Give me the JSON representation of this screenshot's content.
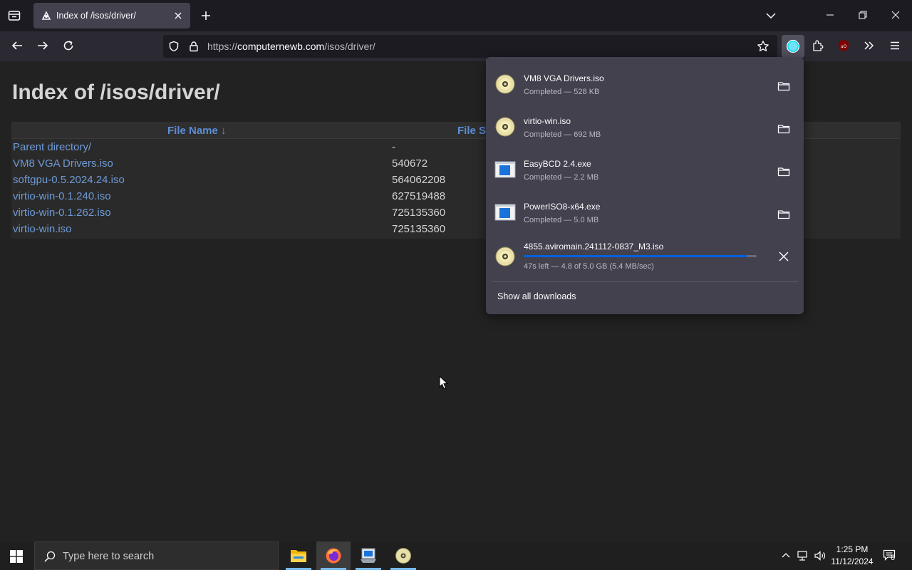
{
  "tab": {
    "title": "Index of /isos/driver/"
  },
  "urlbar": {
    "scheme": "https://",
    "host": "computernewb.com",
    "path": "/isos/driver/"
  },
  "page": {
    "title": "Index of /isos/driver/",
    "columns": {
      "name": "File Name  ↓",
      "size": "File S"
    },
    "rows": [
      {
        "name": "Parent directory/",
        "size": "-"
      },
      {
        "name": "VM8 VGA Drivers.iso",
        "size": "540672"
      },
      {
        "name": "softgpu-0.5.2024.24.iso",
        "size": "564062208"
      },
      {
        "name": "virtio-win-0.1.240.iso",
        "size": "627519488"
      },
      {
        "name": "virtio-win-0.1.262.iso",
        "size": "725135360"
      },
      {
        "name": "virtio-win.iso",
        "size": "725135360"
      }
    ]
  },
  "downloads": {
    "items": [
      {
        "name": "VM8 VGA Drivers.iso",
        "status": "Completed — 528 KB",
        "icon": "disc-icon",
        "action": "folder-icon"
      },
      {
        "name": "virtio-win.iso",
        "status": "Completed — 692 MB",
        "icon": "disc-icon",
        "action": "folder-icon"
      },
      {
        "name": "EasyBCD 2.4.exe",
        "status": "Completed — 2.2 MB",
        "icon": "exe-icon",
        "action": "folder-icon"
      },
      {
        "name": "PowerISO8-x64.exe",
        "status": "Completed — 5.0 MB",
        "icon": "exe-icon",
        "action": "folder-icon"
      },
      {
        "name": "4855.aviromain.241112-0837_M3.iso",
        "status": "47s left — 4.8 of 5.0 GB (5.4 MB/sec)",
        "icon": "disc-icon",
        "action": "cancel-icon",
        "progress": 0.96
      }
    ],
    "show_all": "Show all downloads"
  },
  "taskbar": {
    "search_placeholder": "Type here to search",
    "time": "1:25 PM",
    "date": "11/12/2024",
    "notifications": "6"
  },
  "colors": {
    "accent": "#00ddff",
    "link": "#6e9ad6",
    "progress": "#0060df"
  }
}
